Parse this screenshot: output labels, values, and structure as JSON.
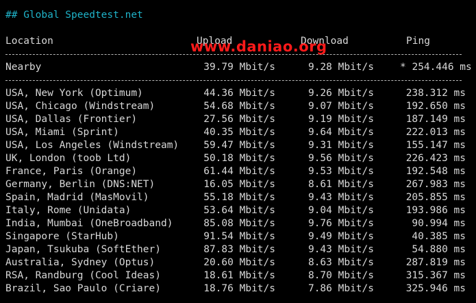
{
  "title": "## Global Speedtest.net",
  "watermark": "www.daniao.org",
  "headers": {
    "location": "Location",
    "upload": "Upload",
    "download": "Download",
    "ping": "Ping"
  },
  "nearby": {
    "location": "Nearby",
    "upload": "39.79 Mbit/s",
    "download": "9.28 Mbit/s",
    "ping": "* 254.446 ms"
  },
  "rows": [
    {
      "location": "USA, New York (Optimum)",
      "upload": "44.36 Mbit/s",
      "download": "9.26 Mbit/s",
      "ping": "238.312 ms"
    },
    {
      "location": "USA, Chicago (Windstream)",
      "upload": "54.68 Mbit/s",
      "download": "9.07 Mbit/s",
      "ping": "192.650 ms"
    },
    {
      "location": "USA, Dallas (Frontier)",
      "upload": "27.56 Mbit/s",
      "download": "9.19 Mbit/s",
      "ping": "187.149 ms"
    },
    {
      "location": "USA, Miami (Sprint)",
      "upload": "40.35 Mbit/s",
      "download": "9.64 Mbit/s",
      "ping": "222.013 ms"
    },
    {
      "location": "USA, Los Angeles (Windstream)",
      "upload": "59.47 Mbit/s",
      "download": "9.31 Mbit/s",
      "ping": "155.147 ms"
    },
    {
      "location": "UK, London (toob Ltd)",
      "upload": "50.18 Mbit/s",
      "download": "9.56 Mbit/s",
      "ping": "226.423 ms"
    },
    {
      "location": "France, Paris (Orange)",
      "upload": "61.44 Mbit/s",
      "download": "9.53 Mbit/s",
      "ping": "192.548 ms"
    },
    {
      "location": "Germany, Berlin (DNS:NET)",
      "upload": "16.05 Mbit/s",
      "download": "8.61 Mbit/s",
      "ping": "267.983 ms"
    },
    {
      "location": "Spain, Madrid (MasMovil)",
      "upload": "55.18 Mbit/s",
      "download": "9.43 Mbit/s",
      "ping": "205.855 ms"
    },
    {
      "location": "Italy, Rome (Unidata)",
      "upload": "53.64 Mbit/s",
      "download": "9.04 Mbit/s",
      "ping": "193.986 ms"
    },
    {
      "location": "India, Mumbai (OneBroadband)",
      "upload": "85.08 Mbit/s",
      "download": "9.76 Mbit/s",
      "ping": "90.994 ms"
    },
    {
      "location": "Singapore (StarHub)",
      "upload": "91.54 Mbit/s",
      "download": "9.49 Mbit/s",
      "ping": "40.385 ms"
    },
    {
      "location": "Japan, Tsukuba (SoftEther)",
      "upload": "87.83 Mbit/s",
      "download": "9.43 Mbit/s",
      "ping": "54.880 ms"
    },
    {
      "location": "Australia, Sydney (Optus)",
      "upload": "20.60 Mbit/s",
      "download": "8.63 Mbit/s",
      "ping": "287.819 ms"
    },
    {
      "location": "RSA, Randburg (Cool Ideas)",
      "upload": "18.61 Mbit/s",
      "download": "8.70 Mbit/s",
      "ping": "315.367 ms"
    },
    {
      "location": "Brazil, Sao Paulo (Criare)",
      "upload": "18.76 Mbit/s",
      "download": "7.86 Mbit/s",
      "ping": "325.946 ms"
    }
  ],
  "colors": {
    "background": "#000000",
    "text": "#d8d8d8",
    "heading": "#1fb3c9",
    "watermark": "#ff1a1a"
  }
}
